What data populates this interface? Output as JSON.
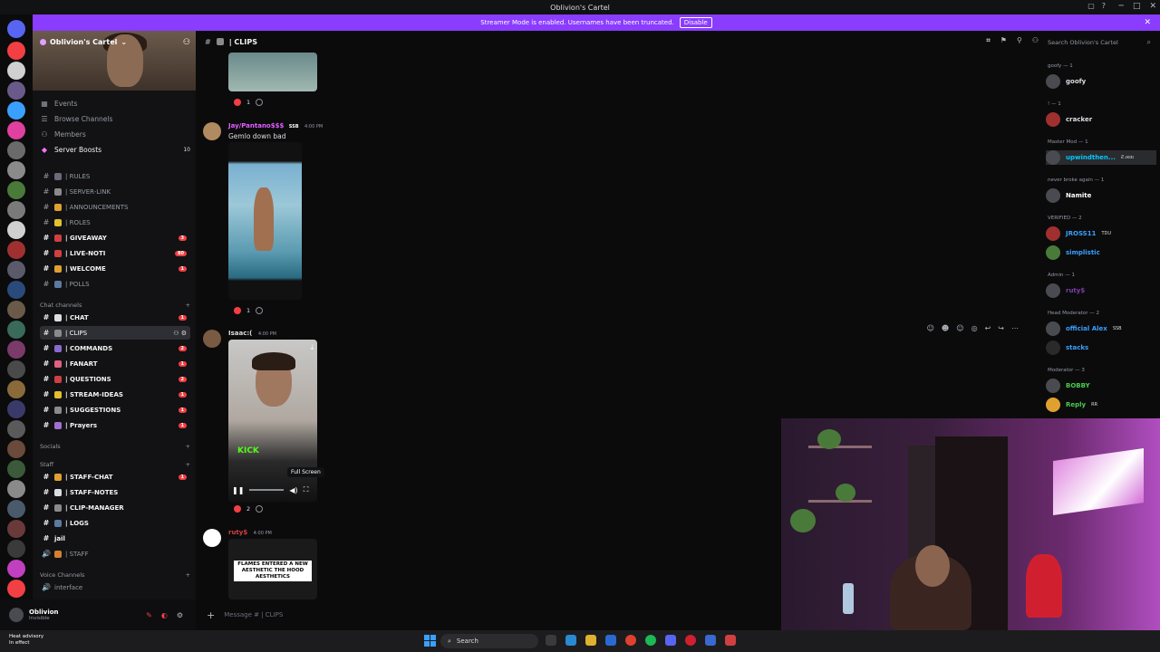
{
  "window": {
    "title": "Oblivion's Cartel"
  },
  "banner": {
    "text": "Streamer Mode is enabled. Usernames have been truncated.",
    "disable_label": "Disable"
  },
  "server": {
    "name": "Oblivion's Cartel"
  },
  "nav": [
    {
      "label": "Events",
      "icon": "calendar-icon",
      "count": ""
    },
    {
      "label": "Browse Channels",
      "icon": "browse-icon",
      "count": ""
    },
    {
      "label": "Members",
      "icon": "members-icon",
      "count": ""
    },
    {
      "label": "Server Boosts",
      "icon": "boost-icon",
      "count": "10"
    }
  ],
  "channels_top": [
    {
      "label": "| RULES",
      "unread": false,
      "pill": ""
    },
    {
      "label": "| SERVER-LINK",
      "unread": false,
      "pill": ""
    },
    {
      "label": "| ANNOUNCEMENTS",
      "unread": false,
      "pill": ""
    },
    {
      "label": "| ROLES",
      "unread": false,
      "pill": ""
    },
    {
      "label": "| GIVEAWAY",
      "unread": true,
      "pill": "3"
    },
    {
      "label": "| LIVE-NOTI",
      "unread": true,
      "pill": "80"
    },
    {
      "label": "| WELCOME",
      "unread": true,
      "pill": "1"
    },
    {
      "label": "| POLLS",
      "unread": false,
      "pill": ""
    }
  ],
  "categories": {
    "chat": "Chat channels",
    "socials": "Socials",
    "staff": "Staff",
    "voice": "Voice Channels"
  },
  "channels_chat": [
    {
      "label": "| CHAT",
      "unread": true,
      "pill": "1",
      "active": false
    },
    {
      "label": "| CLIPS",
      "unread": true,
      "pill": "",
      "active": true
    },
    {
      "label": "| COMMANDS",
      "unread": true,
      "pill": "2",
      "active": false
    },
    {
      "label": "| FANART",
      "unread": true,
      "pill": "1",
      "active": false
    },
    {
      "label": "| QUESTIONS",
      "unread": true,
      "pill": "2",
      "active": false
    },
    {
      "label": "| STREAM-IDEAS",
      "unread": true,
      "pill": "1",
      "active": false
    },
    {
      "label": "| SUGGESTIONS",
      "unread": true,
      "pill": "1",
      "active": false
    },
    {
      "label": "| Prayers",
      "unread": true,
      "pill": "1",
      "active": false
    }
  ],
  "channels_staff": [
    {
      "label": "| STAFF-CHAT",
      "unread": true,
      "pill": "1"
    },
    {
      "label": "| STAFF-NOTES",
      "unread": true,
      "pill": ""
    },
    {
      "label": "| CLIP-MANAGER",
      "unread": true,
      "pill": ""
    },
    {
      "label": "| LOGS",
      "unread": true,
      "pill": ""
    },
    {
      "label": "jail",
      "unread": true,
      "pill": ""
    },
    {
      "label": "| STAFF",
      "unread": false,
      "pill": ""
    }
  ],
  "voice_channels": [
    {
      "label": "interface"
    }
  ],
  "user": {
    "name": "Oblivion",
    "status": "Invisible"
  },
  "header": {
    "channel": "| CLIPS",
    "search_placeholder": "Search Oblivion's Cartel"
  },
  "messages": [
    {
      "author": "Jay/Pantano$$$",
      "tag": "SSB",
      "time": "4:00 PM",
      "text": "Gemlo down bad",
      "reactions": "1"
    },
    {
      "author": "Isaac:(",
      "tag": "",
      "time": "4:00 PM",
      "text": "",
      "reactions": "2",
      "overlay": "KICK"
    },
    {
      "author": "ruty$",
      "tag": "",
      "time": "4:00 PM",
      "text": "",
      "reactions": "",
      "overlay": "FLAMES ENTERED A NEW AESTHETIC THE HOOD AESTHETICS"
    }
  ],
  "first_reaction": "1",
  "tooltip": "Full Screen",
  "composer": {
    "placeholder": "Message # | CLIPS"
  },
  "members": {
    "roles": [
      {
        "label": "goofy — 1"
      },
      {
        "label": "! — 1"
      },
      {
        "label": "Master Mod — 1"
      },
      {
        "label": "never broke again — 1"
      },
      {
        "label": "VERIFIED — 2"
      },
      {
        "label": "Admin — 1"
      },
      {
        "label": "Head Moderator — 2"
      },
      {
        "label": "Moderator — 3"
      }
    ],
    "list": [
      {
        "name": "goofy",
        "color": "#dbdee1",
        "tag": ""
      },
      {
        "name": "cracker",
        "color": "#dbdee1",
        "tag": ""
      },
      {
        "name": "upwindthen...",
        "color": "#00c8ff",
        "tag": "Ƨ.ιĸαι"
      },
      {
        "name": "Namite",
        "color": "#ffffff",
        "tag": ""
      },
      {
        "name": "JROSS11",
        "color": "#3aa0ff",
        "tag": "TDU"
      },
      {
        "name": "simplistic",
        "color": "#3aa0ff",
        "tag": ""
      },
      {
        "name": "ruty$",
        "color": "#7b3fa8",
        "tag": ""
      },
      {
        "name": "official Alex",
        "color": "#3aa0ff",
        "tag": "SSB"
      },
      {
        "name": "stacks",
        "color": "#3aa0ff",
        "tag": ""
      },
      {
        "name": "BOBBY",
        "color": "#4ccb4c",
        "tag": ""
      },
      {
        "name": "Reply",
        "color": "#4ccb4c",
        "tag": "RR"
      }
    ]
  },
  "taskbar": {
    "weather_temp": "Heat advisory",
    "weather_sub": "In effect",
    "search_label": "Search"
  },
  "colors": {
    "accent": "#8a3cff",
    "unread_pill": "#f23f43"
  }
}
